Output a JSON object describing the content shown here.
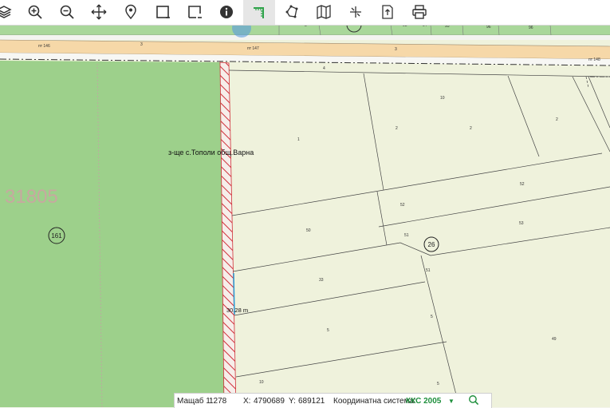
{
  "toolbar": {
    "icons": [
      "layers-icon",
      "zoom-in-icon",
      "zoom-out-icon",
      "pan-icon",
      "location-pin-icon",
      "select-rectangle-icon",
      "select-rectangle-minus-icon",
      "info-icon",
      "measure-distance-icon",
      "measure-area-icon",
      "map-icon",
      "split-icon",
      "export-icon",
      "print-icon"
    ],
    "active": "measure-distance-icon"
  },
  "map": {
    "zone_number": "31805",
    "zone_circle_label": "161",
    "parcel_circle_label": "26",
    "locality_label": "з-ще с.Тополи общ.Варна",
    "measurement_label": "30.28 m",
    "road_labels": [
      "пт 146",
      "пт 147",
      "пт 148"
    ],
    "road_numbers": [
      "3",
      "3",
      "4"
    ],
    "small_labels": [
      "1",
      "10",
      "2",
      "2",
      "2",
      "50",
      "52",
      "52",
      "53",
      "51",
      "51",
      "26",
      "33",
      "5",
      "5",
      "49",
      "10",
      "6",
      "7",
      "4"
    ],
    "top_parcel_labels": [
      "93",
      "94",
      "95",
      "96",
      "8"
    ],
    "colors": {
      "zone_fill": "#9dd08b",
      "parcel_fill": "#eff2dc",
      "road_fill": "#f6d8a8",
      "hatch": "#d0303a",
      "measure_line": "#2a9ed8"
    }
  },
  "status": {
    "scale_label": "Мащаб 1:",
    "scale_value": "1278",
    "x_label": "X:",
    "x_value": "4790689",
    "y_label": "Y:",
    "y_value": "689121",
    "crs_label": "Координатна система:",
    "crs_value": "ККС 2005"
  }
}
